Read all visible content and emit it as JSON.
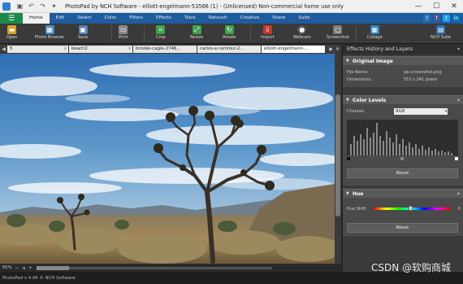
{
  "window": {
    "title": "PhotoPad by NCH Software - elliott-engelmann-53566 (1) - (Unlicensed) Non-commercial home use only"
  },
  "menubar": {
    "items": [
      "Home",
      "Edit",
      "Select",
      "Color",
      "Filters",
      "Effects",
      "Tools",
      "Retouch",
      "Creative",
      "Share",
      "Suite"
    ],
    "active": "Home"
  },
  "toolbar": {
    "open": "Open",
    "photo_browser": "Photo Browser",
    "save": "Save",
    "print": "Print",
    "crop": "Crop",
    "resize": "Resize",
    "rotate": "Rotate",
    "import": "Import",
    "webcam": "Webcam",
    "screenshot": "Screenshot",
    "collage": "Collage",
    "nch_suite": "NCH Suite"
  },
  "tabs": [
    "5",
    "beach2",
    "brooke-cagle-2746...",
    "carlos-e-ramirez-2...",
    "elliott-engelmann-..."
  ],
  "active_tab": "elliott-engelmann-...",
  "canvas": {
    "zoom": "65%"
  },
  "status": {
    "text": "PhotoPad v 4.06 © NCH Software"
  },
  "panel": {
    "title": "Effects History and Layers",
    "original_image": {
      "header": "Original Image",
      "file_name_label": "File Name:",
      "file_name_value": "pp-screenshot.png",
      "dimensions_label": "Dimensions:",
      "dimensions_value": "553 x 341 pixels"
    },
    "color_levels": {
      "header": "Color Levels",
      "channel_label": "Channel:",
      "channel_value": "RGB",
      "reset_label": "Reset"
    },
    "hue": {
      "header": "Hue",
      "hue_shift_label": "Hue Shift:",
      "hue_shift_value": "0",
      "reset_label": "Reset"
    }
  },
  "watermark": "CSDN @软购商城",
  "colors": {
    "menubar": "#1e5c9e",
    "file_button": "#1a8a4a",
    "panel_bg": "#3b3b3b"
  }
}
